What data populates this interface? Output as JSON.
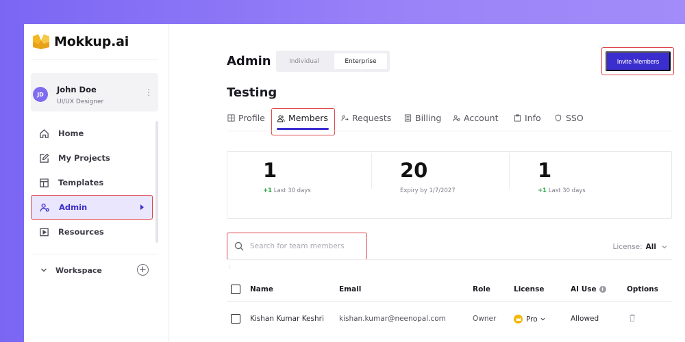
{
  "brand": {
    "name": "Mokkup.ai",
    "accent": "#3b2ecf",
    "highlight": "#e0424a"
  },
  "user": {
    "initials": "JD",
    "name": "John Doe",
    "role": "UI/UX Designer",
    "more": "⋮"
  },
  "sidebar": {
    "items": [
      {
        "label": "Home",
        "icon": "home-icon"
      },
      {
        "label": "My Projects",
        "icon": "edit-icon"
      },
      {
        "label": "Templates",
        "icon": "layout-icon"
      },
      {
        "label": "Admin",
        "icon": "users-icon",
        "active": true
      },
      {
        "label": "Resources",
        "icon": "play-icon"
      }
    ],
    "workspace_label": "Workspace",
    "workspace_add": "+"
  },
  "header": {
    "title": "Admin",
    "segments": [
      "Individual",
      "Enterprise"
    ],
    "active_segment": "Enterprise",
    "invite_label": "Invite Members"
  },
  "org": {
    "name": "Testing"
  },
  "tabs": [
    {
      "label": "Profile",
      "icon": "profile-icon"
    },
    {
      "label": "Members",
      "icon": "members-icon",
      "active": true
    },
    {
      "label": "Requests",
      "icon": "requests-icon"
    },
    {
      "label": "Billing",
      "icon": "billing-icon"
    },
    {
      "label": "Account",
      "icon": "account-icon"
    },
    {
      "label": "Info",
      "icon": "info-icon"
    },
    {
      "label": "SSO",
      "icon": "shield-icon"
    }
  ],
  "stats": [
    {
      "value": "1",
      "delta": "+1",
      "note": "Last 30 days"
    },
    {
      "value": "20",
      "delta": "",
      "note": "Expiry by 1/7/2027"
    },
    {
      "value": "1",
      "delta": "+1",
      "note": "Last 30 days"
    }
  ],
  "search": {
    "placeholder": "Search for team members",
    "value": ""
  },
  "license_filter": {
    "label": "License:",
    "value": "All"
  },
  "table": {
    "columns": [
      "Name",
      "Email",
      "Role",
      "License",
      "AI Use",
      "Options"
    ],
    "ai_info": "i",
    "rows": [
      {
        "name": "Kishan Kumar Keshri",
        "email": "kishan.kumar@neenopal.com",
        "role": "Owner",
        "license": "Pro",
        "ai_use": "Allowed"
      }
    ]
  }
}
